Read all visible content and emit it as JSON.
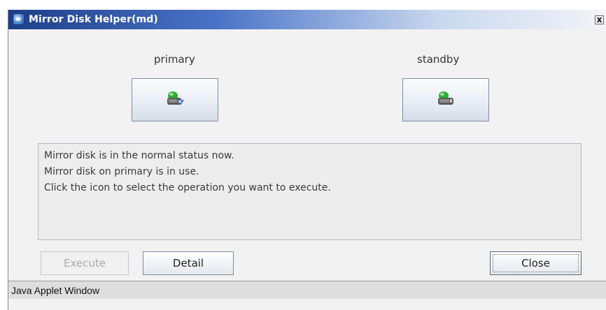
{
  "window": {
    "title": "Mirror Disk Helper(md)",
    "close_glyph": "x"
  },
  "servers": {
    "primary_label": "primary",
    "standby_label": "standby",
    "primary_icon": "disk-active-icon",
    "standby_icon": "disk-icon"
  },
  "messages": [
    "Mirror disk is in the normal status now.",
    "Mirror disk on primary is in use.",
    "Click the icon to select the operation you want to execute."
  ],
  "buttons": {
    "execute": "Execute",
    "detail": "Detail",
    "close": "Close"
  },
  "status_bar": "Java Applet Window",
  "colors": {
    "active_green": "#2fae33",
    "disk_blue": "#3c7fd6",
    "disk_gray": "#5a5a5a"
  }
}
